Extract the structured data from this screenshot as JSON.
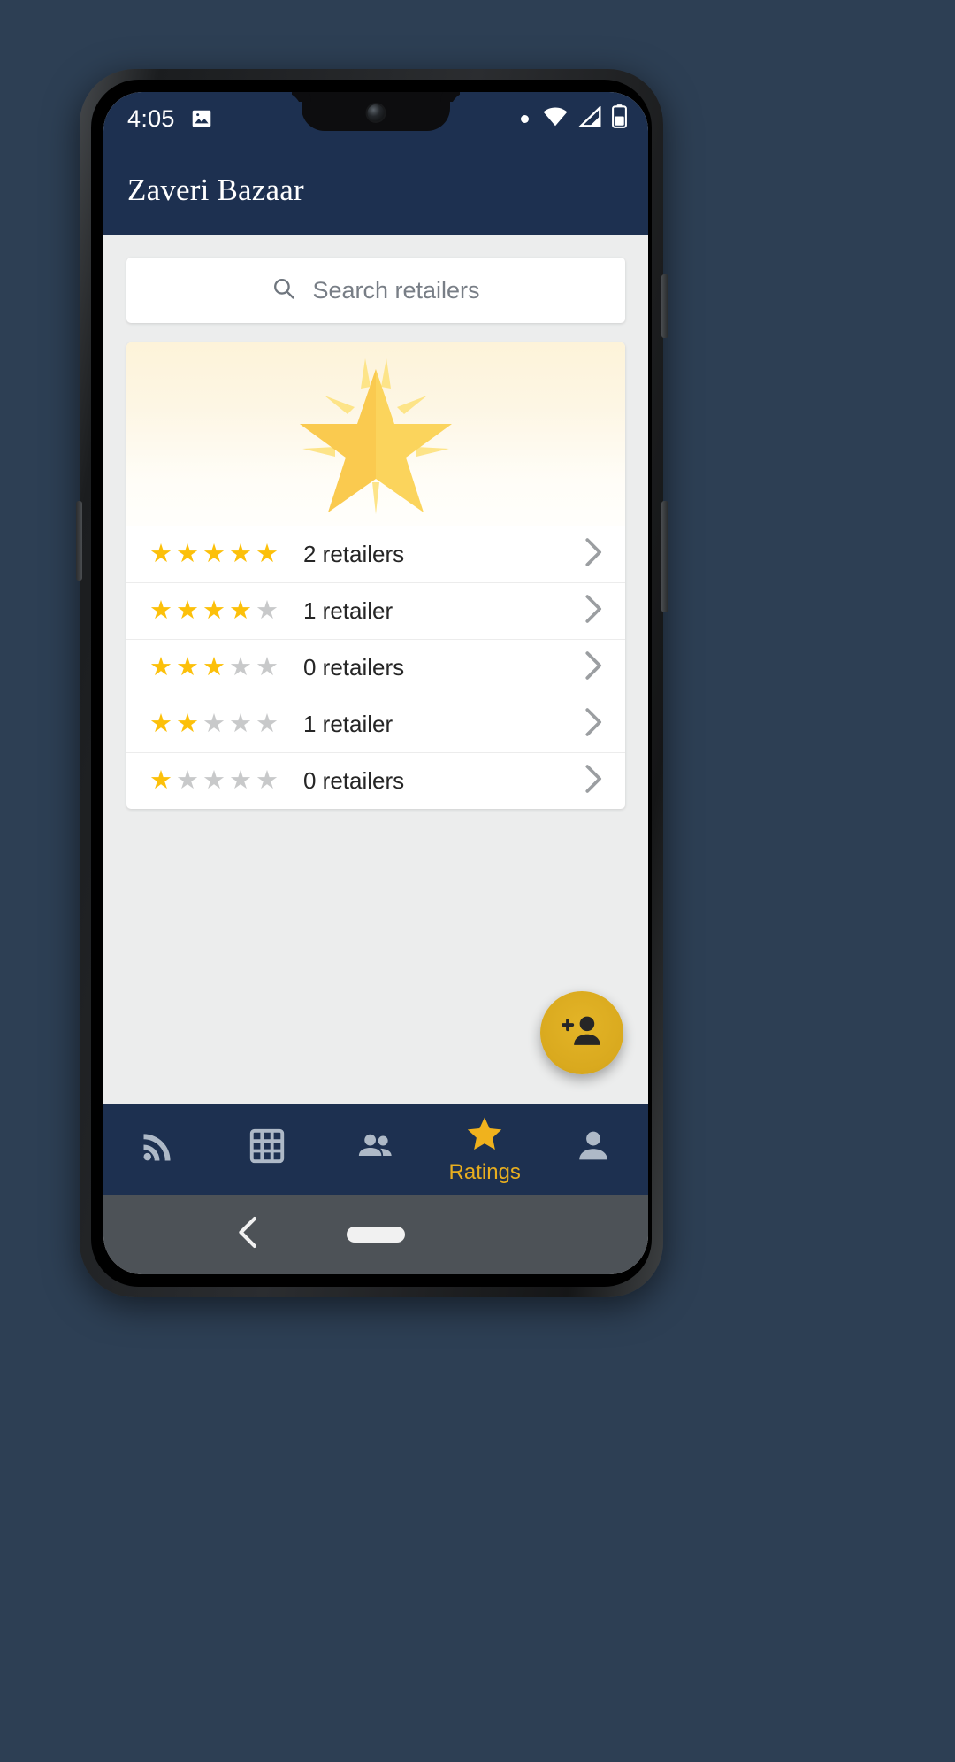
{
  "status_bar": {
    "time": "4:05",
    "icons": [
      "image-icon",
      "dot-icon",
      "wifi-icon",
      "cellular-signal-icon",
      "battery-icon"
    ]
  },
  "app_bar": {
    "title": "Zaveri Bazaar"
  },
  "search": {
    "placeholder": "Search retailers",
    "icon": "search-icon",
    "value": ""
  },
  "hero": {
    "illustration": "shining-star-illustration"
  },
  "ratings": {
    "rows": [
      {
        "stars_filled": 5,
        "stars_total": 5,
        "label": "2 retailers",
        "chevron": "chevron-right-icon"
      },
      {
        "stars_filled": 4,
        "stars_total": 5,
        "label": "1 retailer",
        "chevron": "chevron-right-icon"
      },
      {
        "stars_filled": 3,
        "stars_total": 5,
        "label": "0 retailers",
        "chevron": "chevron-right-icon"
      },
      {
        "stars_filled": 2,
        "stars_total": 5,
        "label": "1 retailer",
        "chevron": "chevron-right-icon"
      },
      {
        "stars_filled": 1,
        "stars_total": 5,
        "label": "0 retailers",
        "chevron": "chevron-right-icon"
      }
    ]
  },
  "fab": {
    "icon": "person-add-icon",
    "label": ""
  },
  "bottom_nav": {
    "items": [
      {
        "icon": "rss-feed-icon",
        "label": "",
        "active": false
      },
      {
        "icon": "grid-table-icon",
        "label": "",
        "active": false
      },
      {
        "icon": "group-people-icon",
        "label": "",
        "active": false
      },
      {
        "icon": "star-icon",
        "label": "Ratings",
        "active": true
      },
      {
        "icon": "person-icon",
        "label": "",
        "active": false
      }
    ]
  },
  "system_nav": {
    "back": "back-chevron-icon",
    "home": "home-pill-icon"
  },
  "colors": {
    "app_bar": "#1d3050",
    "accent_gold": "#fcc00a",
    "fab": "#d9a91e",
    "star_empty": "#c8c9ca",
    "background": "#eceded",
    "page_backdrop": "#2d3f54"
  }
}
